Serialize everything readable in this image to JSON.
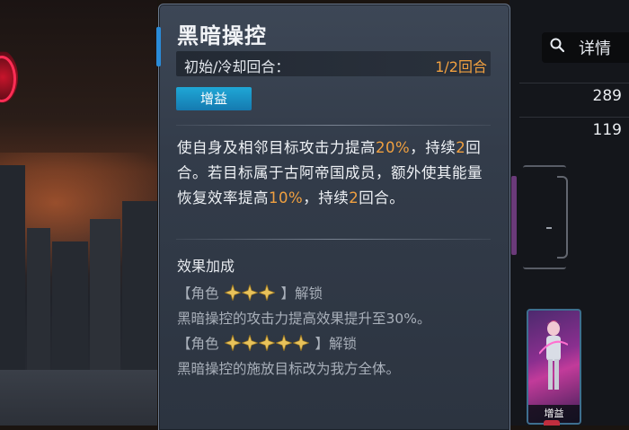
{
  "skill": {
    "name": "黑暗操控",
    "cooldown_label": "初始/冷却回合：",
    "cooldown_value": "1/2回合",
    "tag": "增益",
    "description": [
      {
        "t": "使自身及相邻目标攻击力提高",
        "hl": false
      },
      {
        "t": "20%",
        "hl": true
      },
      {
        "t": "，持续",
        "hl": false
      },
      {
        "t": "2",
        "hl": true
      },
      {
        "t": "回合。若目标属于古阿帝国成员，额外使其能量恢复效率提高",
        "hl": false
      },
      {
        "t": "10%",
        "hl": true
      },
      {
        "t": "，持续",
        "hl": false
      },
      {
        "t": "2",
        "hl": true
      },
      {
        "t": "回合。",
        "hl": false
      }
    ],
    "bonus_title": "效果加成",
    "unlocks": [
      {
        "prefix": "【角色",
        "stars": 3,
        "suffix": "】解锁",
        "effect": "黑暗操控的攻击力提高效果提升至30%。"
      },
      {
        "prefix": "【角色",
        "stars": 5,
        "suffix": "】解锁",
        "effect": "黑暗操控的施放目标改为我方全体。"
      }
    ]
  },
  "sidebar": {
    "detail_label": "详情",
    "stats": [
      "289",
      "119"
    ],
    "hero_tag": "增益"
  },
  "colors": {
    "highlight": "#f0a040",
    "badge": "#1fa7d6",
    "star": "#e8c25a"
  }
}
